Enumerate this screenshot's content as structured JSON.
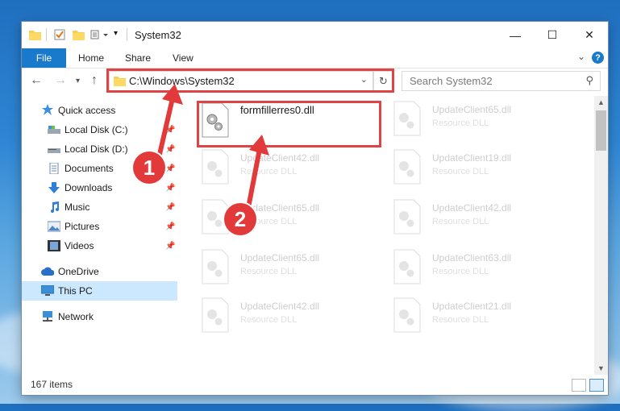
{
  "window": {
    "title": "System32",
    "controls": {
      "minimize": "—",
      "maximize": "☐",
      "close": "✕"
    }
  },
  "ribbon": {
    "tabs": [
      "File",
      "Home",
      "Share",
      "View"
    ],
    "help": "?"
  },
  "address": {
    "path": "C:\\Windows\\System32",
    "search_placeholder": "Search System32"
  },
  "sidebar": {
    "items": [
      {
        "label": "Quick access",
        "icon": "star-icon",
        "pinned": false
      },
      {
        "label": "Local Disk (C:)",
        "icon": "drive-icon",
        "pinned": true
      },
      {
        "label": "Local Disk (D:)",
        "icon": "drive-icon",
        "pinned": true
      },
      {
        "label": "Documents",
        "icon": "documents-icon",
        "pinned": true
      },
      {
        "label": "Downloads",
        "icon": "downloads-icon",
        "pinned": true
      },
      {
        "label": "Music",
        "icon": "music-icon",
        "pinned": true
      },
      {
        "label": "Pictures",
        "icon": "pictures-icon",
        "pinned": true
      },
      {
        "label": "Videos",
        "icon": "videos-icon",
        "pinned": true
      },
      {
        "label": "OneDrive",
        "icon": "cloud-icon",
        "pinned": false
      },
      {
        "label": "This PC",
        "icon": "computer-icon",
        "pinned": false,
        "selected": true
      },
      {
        "label": "Network",
        "icon": "network-icon",
        "pinned": false
      }
    ]
  },
  "files": {
    "highlighted": {
      "name": "formfillerres0.dll"
    },
    "faded": [
      {
        "name": "UpdateClient65.dll",
        "type": "Resource DLL"
      },
      {
        "name": "UpdateClient42.dll",
        "type": "Resource DLL"
      },
      {
        "name": "UpdateClient19.dll",
        "type": "Resource DLL"
      },
      {
        "name": "UpdateClient65.dll",
        "type": "Resource DLL"
      },
      {
        "name": "UpdateClient42.dll",
        "type": "Resource DLL"
      },
      {
        "name": "UpdateClient65.dll",
        "type": "Resource DLL"
      },
      {
        "name": "UpdateClient63.dll",
        "type": "Resource DLL"
      },
      {
        "name": "UpdateClient42.dll",
        "type": "Resource DLL"
      },
      {
        "name": "UpdateClient21.dll",
        "type": "Resource DLL"
      }
    ]
  },
  "status": {
    "item_count": "167 items"
  },
  "annotations": {
    "step1": "1",
    "step2": "2",
    "color": "#e04343"
  }
}
